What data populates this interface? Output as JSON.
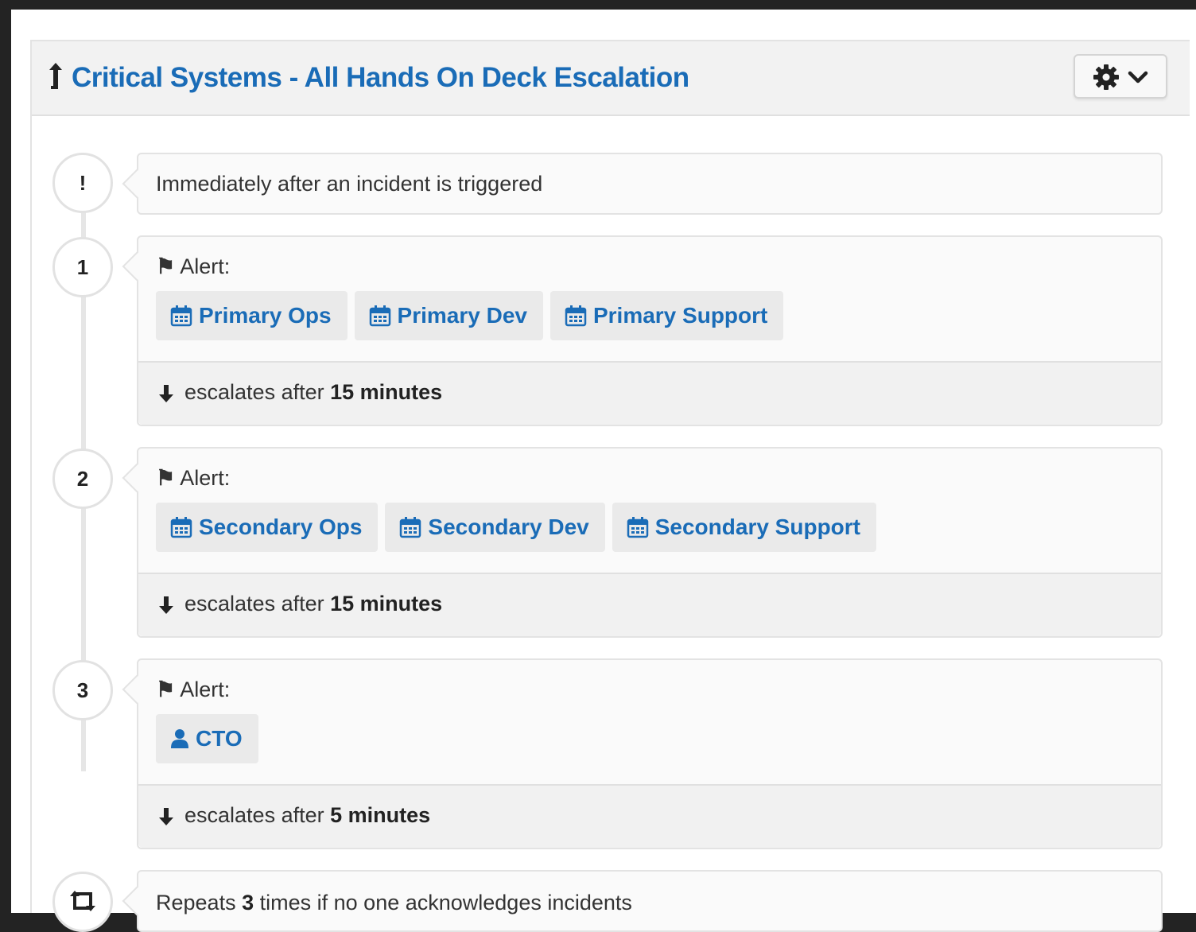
{
  "header": {
    "title": "Critical Systems - All Hands On Deck Escalation",
    "title_icon": "escalation-up-arrow-icon",
    "settings_icon": "gear-icon"
  },
  "trigger": {
    "marker": "!",
    "text": "Immediately after an incident is triggered"
  },
  "rules": [
    {
      "number": "1",
      "alert_label": "Alert:",
      "targets": [
        {
          "icon": "calendar-icon",
          "label": "Primary Ops"
        },
        {
          "icon": "calendar-icon",
          "label": "Primary Dev"
        },
        {
          "icon": "calendar-icon",
          "label": "Primary Support"
        }
      ],
      "escalate_prefix": "escalates after",
      "escalate_value": "15 minutes"
    },
    {
      "number": "2",
      "alert_label": "Alert:",
      "targets": [
        {
          "icon": "calendar-icon",
          "label": "Secondary Ops"
        },
        {
          "icon": "calendar-icon",
          "label": "Secondary Dev"
        },
        {
          "icon": "calendar-icon",
          "label": "Secondary Support"
        }
      ],
      "escalate_prefix": "escalates after",
      "escalate_value": "15 minutes"
    },
    {
      "number": "3",
      "alert_label": "Alert:",
      "targets": [
        {
          "icon": "user-icon",
          "label": "CTO"
        }
      ],
      "escalate_prefix": "escalates after",
      "escalate_value": "5 minutes"
    }
  ],
  "repeat": {
    "icon": "retweet-repeat-icon",
    "prefix": "Repeats",
    "count": "3",
    "suffix": "times if no one acknowledges incidents"
  },
  "colors": {
    "link_blue": "#1a6cb7",
    "header_bg": "#f2f2f2",
    "card_bg": "#fafafa",
    "escalate_bg": "#f1f1f1"
  }
}
